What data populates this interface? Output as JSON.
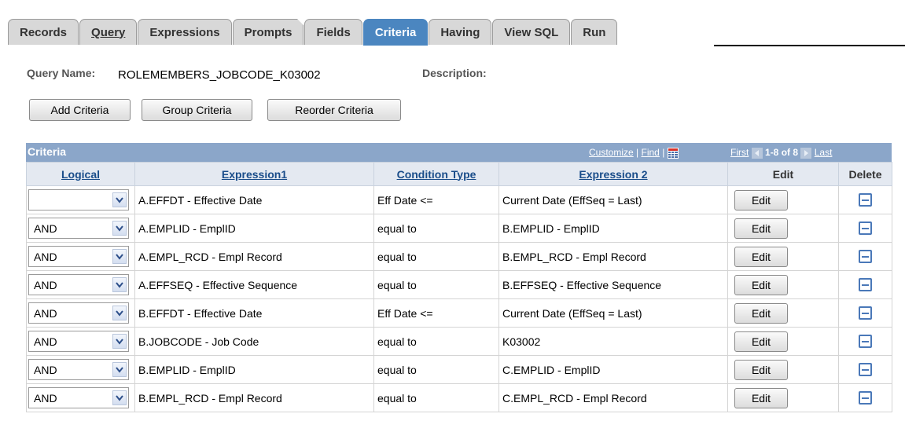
{
  "tabs": [
    {
      "label": "Records",
      "underline": false
    },
    {
      "label": "Query",
      "underline": true
    },
    {
      "label": "Expressions",
      "underline": false
    },
    {
      "label": "Prompts",
      "underline": false
    },
    {
      "label": "Fields",
      "underline": false
    },
    {
      "label": "Criteria",
      "underline": false,
      "active": true
    },
    {
      "label": "Having",
      "underline": false
    },
    {
      "label": "View SQL",
      "underline": false
    },
    {
      "label": "Run",
      "underline": false
    }
  ],
  "header": {
    "query_name_label": "Query Name:",
    "query_name_value": "ROLEMEMBERS_JOBCODE_K03002",
    "description_label": "Description:"
  },
  "buttons": {
    "add_criteria": "Add Criteria",
    "group_criteria": "Group Criteria",
    "reorder_criteria": "Reorder Criteria"
  },
  "grid": {
    "title": "Criteria",
    "customize": "Customize",
    "separator": "|",
    "find": "Find",
    "first": "First",
    "range": "1-8 of 8",
    "last": "Last",
    "columns": {
      "logical": "Logical",
      "expression1": "Expression1",
      "condition_type": "Condition Type",
      "expression2": "Expression 2",
      "edit": "Edit",
      "delete": "Delete"
    },
    "edit_label": "Edit",
    "rows": [
      {
        "logical": "",
        "expr1": "A.EFFDT - Effective Date",
        "cond": "Eff Date <=",
        "expr2": "Current Date (EffSeq = Last)"
      },
      {
        "logical": "AND",
        "expr1": "A.EMPLID - EmplID",
        "cond": "equal to",
        "expr2": "B.EMPLID - EmplID"
      },
      {
        "logical": "AND",
        "expr1": "A.EMPL_RCD - Empl Record",
        "cond": "equal to",
        "expr2": "B.EMPL_RCD - Empl Record"
      },
      {
        "logical": "AND",
        "expr1": "A.EFFSEQ - Effective Sequence",
        "cond": "equal to",
        "expr2": "B.EFFSEQ - Effective Sequence"
      },
      {
        "logical": "AND",
        "expr1": "B.EFFDT - Effective Date",
        "cond": "Eff Date <=",
        "expr2": "Current Date (EffSeq = Last)"
      },
      {
        "logical": "AND",
        "expr1": "B.JOBCODE - Job Code",
        "cond": "equal to",
        "expr2": "K03002"
      },
      {
        "logical": "AND",
        "expr1": "B.EMPLID - EmplID",
        "cond": "equal to",
        "expr2": "C.EMPLID - EmplID"
      },
      {
        "logical": "AND",
        "expr1": "B.EMPL_RCD - Empl Record",
        "cond": "equal to",
        "expr2": "C.EMPL_RCD - Empl Record"
      }
    ]
  },
  "colors": {
    "active_tab": "#4b86c0",
    "grid_header": "#8ba6c9",
    "column_header_text": "#1a4d8a",
    "delete_icon": "#4a78b8"
  }
}
